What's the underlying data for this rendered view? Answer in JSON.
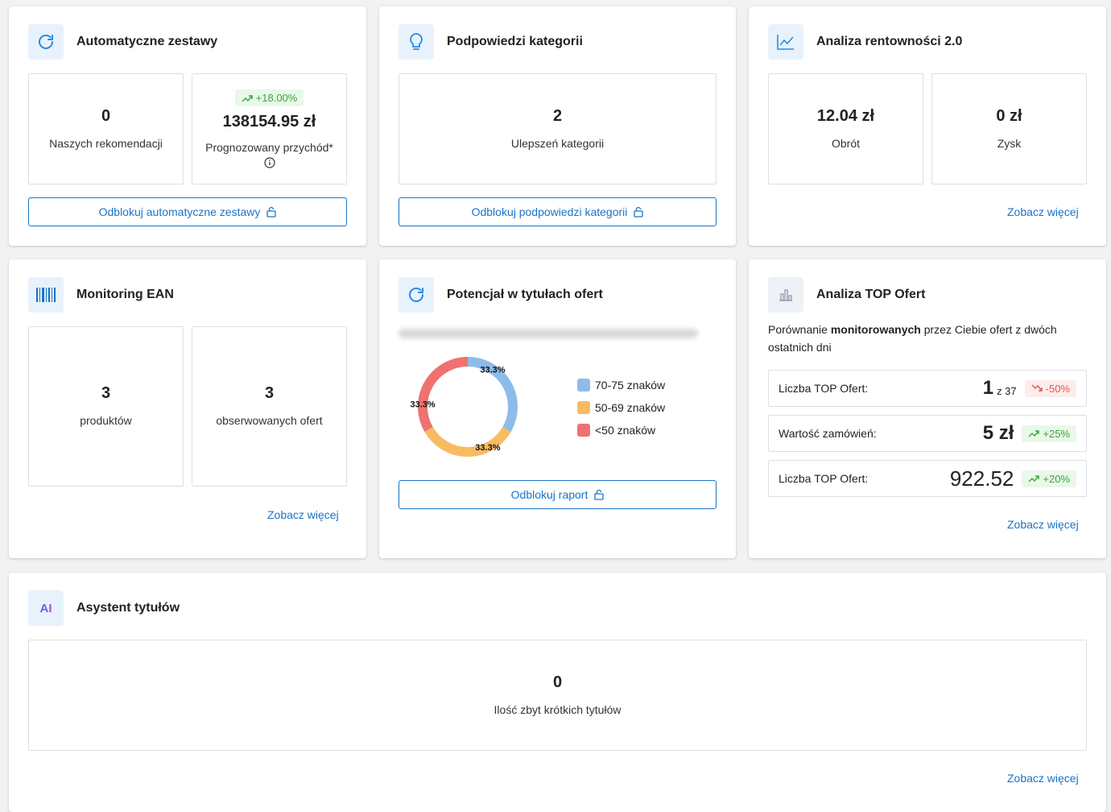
{
  "cards": {
    "auto_sets": {
      "title": "Automatyczne zestawy",
      "stat1_value": "0",
      "stat1_label": "Naszych rekomendacji",
      "stat2_badge": "+18.00%",
      "stat2_value": "138154.95 zł",
      "stat2_label": "Prognozowany przychód*",
      "button": "Odblokuj automatyczne zestawy"
    },
    "category_hints": {
      "title": "Podpowiedzi kategorii",
      "stat_value": "2",
      "stat_label": "Ulepszeń kategorii",
      "button": "Odblokuj podpowiedzi kategorii"
    },
    "profitability": {
      "title": "Analiza rentowności 2.0",
      "stat1_value": "12.04 zł",
      "stat1_label": "Obrót",
      "stat2_value": "0 zł",
      "stat2_label": "Zysk",
      "link": "Zobacz więcej"
    },
    "ean": {
      "title": "Monitoring EAN",
      "stat1_value": "3",
      "stat1_label": "produktów",
      "stat2_value": "3",
      "stat2_label": "obserwowanych ofert",
      "link": "Zobacz więcej"
    },
    "title_potential": {
      "title": "Potencjał w tytułach ofert",
      "button": "Odblokuj raport"
    },
    "top_offers": {
      "title": "Analiza TOP Ofert",
      "desc_before": "Porównanie ",
      "desc_bold": "monitorowanych",
      "desc_after": " przez Ciebie ofert z dwóch ostatnich dni",
      "rows": [
        {
          "label": "Liczba TOP Ofert:",
          "value": "1",
          "sub": "z 37",
          "badge": "-50%",
          "trend": "down"
        },
        {
          "label": "Wartość zamówień:",
          "value": "5 zł",
          "sub": "",
          "badge": "+25%",
          "trend": "up"
        },
        {
          "label": "Liczba TOP Ofert:",
          "value": "922.52",
          "sub": "",
          "badge": "+20%",
          "trend": "up"
        }
      ],
      "link": "Zobacz więcej"
    },
    "title_assistant": {
      "icon_text": "AI",
      "title": "Asystent tytułów",
      "stat_value": "0",
      "stat_label": "Ilość zbyt krótkich tytułów",
      "link": "Zobacz więcej"
    }
  },
  "chart_data": {
    "type": "pie",
    "categories": [
      "70-75 znaków",
      "50-69 znaków",
      "<50 znaków"
    ],
    "values": [
      33.3,
      33.3,
      33.3
    ],
    "labels": [
      "33.3%",
      "33.3%",
      "33.3%"
    ],
    "colors": [
      "#8ebcea",
      "#f7bc63",
      "#f07171"
    ],
    "legend": "right"
  },
  "colors": {
    "accent": "#1a73c8",
    "positive": "#3aa53a",
    "negative": "#e0544f"
  }
}
